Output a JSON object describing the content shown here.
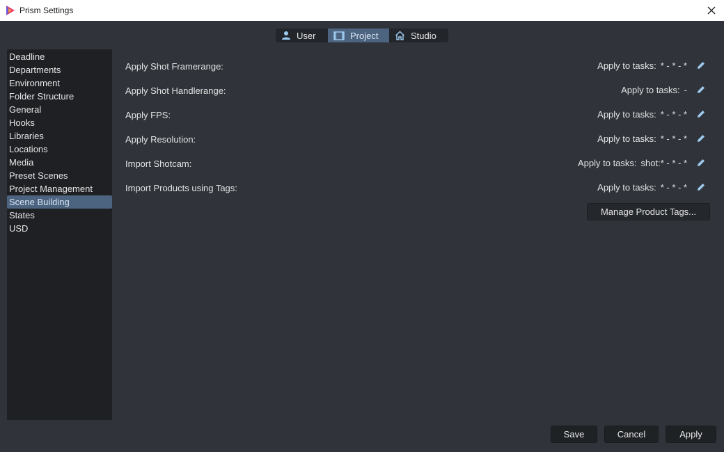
{
  "window": {
    "title": "Prism Settings"
  },
  "tabs": [
    {
      "label": "User",
      "icon": "user-icon"
    },
    {
      "label": "Project",
      "icon": "film-icon"
    },
    {
      "label": "Studio",
      "icon": "home-icon"
    }
  ],
  "sidebar": {
    "items": [
      "Deadline",
      "Departments",
      "Environment",
      "Folder Structure",
      "General",
      "Hooks",
      "Libraries",
      "Locations",
      "Media",
      "Preset Scenes",
      "Project Management",
      "Scene Building",
      "States",
      "USD"
    ],
    "selected": "Scene Building"
  },
  "rows": [
    {
      "label": "Apply Shot Framerange:",
      "prefix": "Apply to tasks:",
      "tasks": "* - * - *"
    },
    {
      "label": "Apply Shot Handlerange:",
      "prefix": "Apply to tasks:",
      "tasks": "-"
    },
    {
      "label": "Apply FPS:",
      "prefix": "Apply to tasks:",
      "tasks": "* - * - *"
    },
    {
      "label": "Apply Resolution:",
      "prefix": "Apply to tasks:",
      "tasks": "* - * - *"
    },
    {
      "label": "Import Shotcam:",
      "prefix": "Apply to tasks:",
      "tasks": "shot:* - * - *"
    },
    {
      "label": "Import Products using Tags:",
      "prefix": "Apply to tasks:",
      "tasks": "* - * - *"
    }
  ],
  "manage_button": "Manage Product Tags...",
  "footer": {
    "save": "Save",
    "cancel": "Cancel",
    "apply": "Apply"
  },
  "colors": {
    "accent": "#4d6480",
    "background": "#30343a",
    "sidebar": "#1e2023",
    "icon": "#9ecbf0"
  }
}
